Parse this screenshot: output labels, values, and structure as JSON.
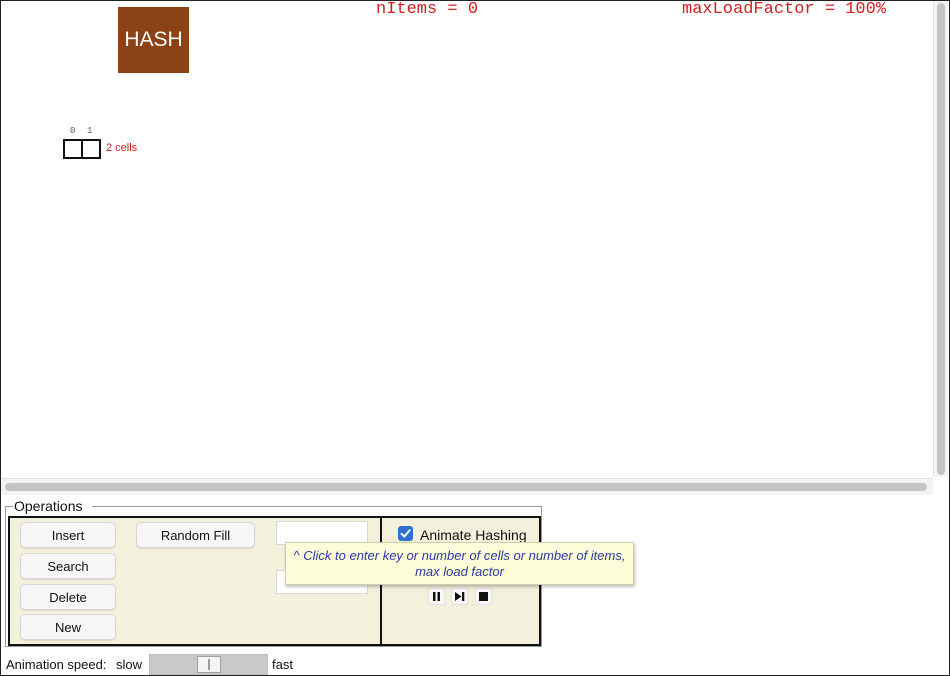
{
  "visualization": {
    "logo_text": "HASH",
    "n_items_text": "nItems = 0",
    "max_load_factor_text": "maxLoadFactor = 100%",
    "cell_indices": [
      "0",
      "1"
    ],
    "cell_count_label": "2 cells"
  },
  "operations": {
    "legend": "Operations",
    "buttons": {
      "insert": "Insert",
      "search": "Search",
      "delete": "Delete",
      "new": "New",
      "random_fill": "Random Fill"
    },
    "key_input_value": "",
    "load_factor_input_value": "",
    "animate_hashing": {
      "label": "Animate Hashing",
      "checked": true
    },
    "tooltip": {
      "line1": "^ Click to enter key or number of cells or number of items,",
      "line2": "max load factor"
    }
  },
  "controls": {
    "icons": [
      "pause-icon",
      "step-icon",
      "stop-icon"
    ]
  },
  "speed": {
    "label": "Animation speed:",
    "slow": "slow",
    "fast": "fast",
    "value_fraction": 0.5
  },
  "colors": {
    "logo_bg": "#8b4315",
    "status_red": "#d02020",
    "panel_bg": "#f3f1dc",
    "tooltip_bg": "#fcfcd9",
    "tooltip_text": "#2f3aa0",
    "checkbox_blue": "#2f6fcf"
  }
}
